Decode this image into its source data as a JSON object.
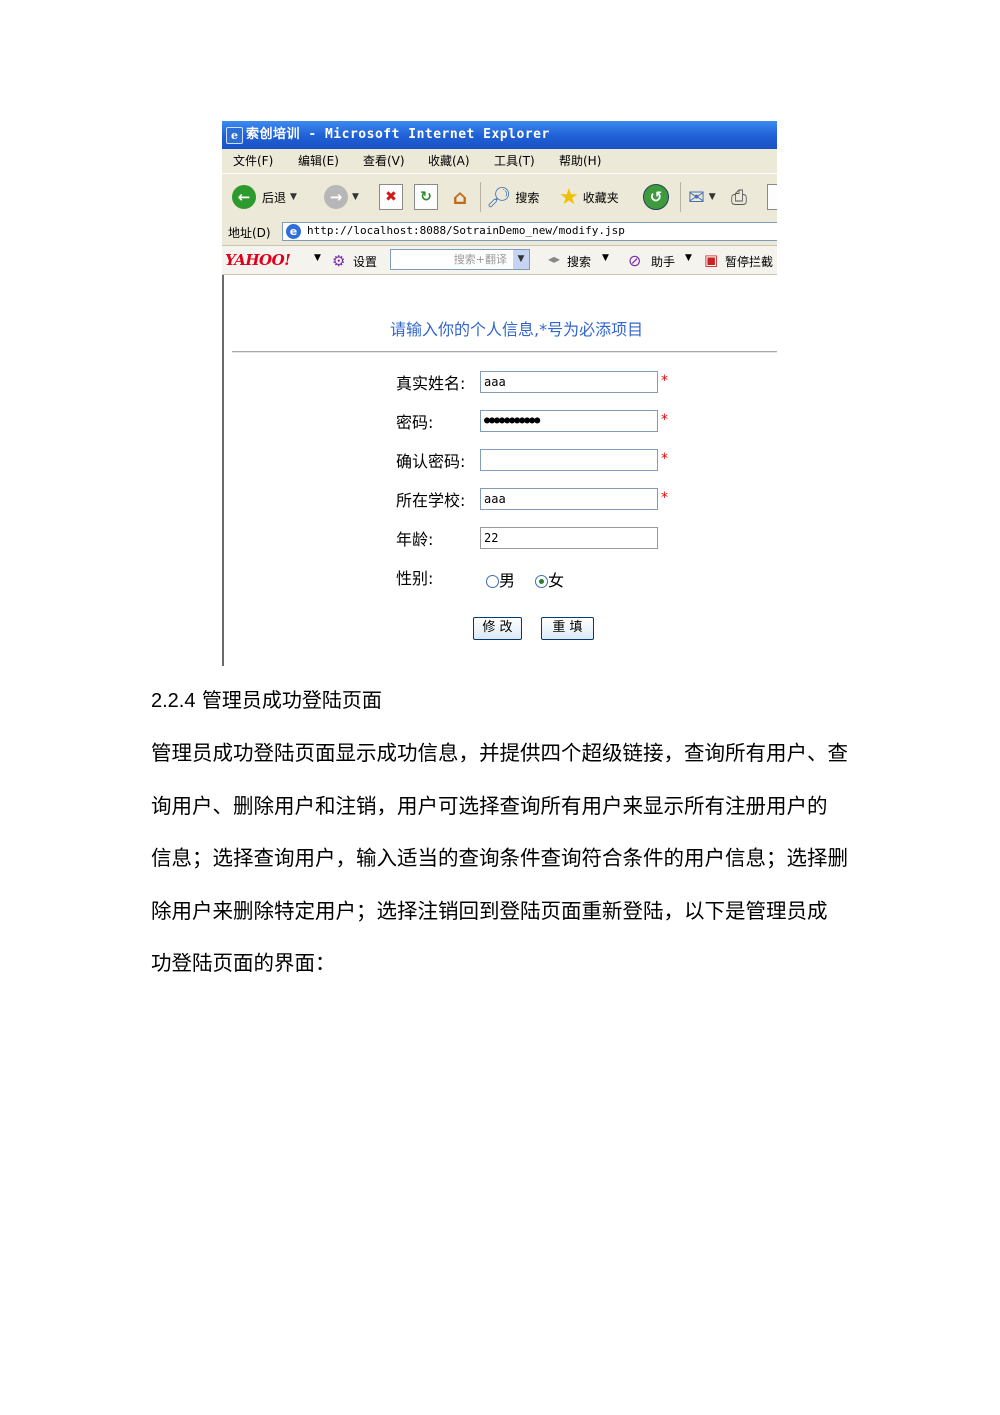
{
  "browser": {
    "window_title": "索创培训 - Microsoft Internet Explorer",
    "menu": [
      "文件(F)",
      "编辑(E)",
      "查看(V)",
      "收藏(A)",
      "工具(T)",
      "帮助(H)"
    ],
    "toolbar": {
      "back": "后退",
      "search": "搜索",
      "favorites": "收藏夹"
    },
    "address": {
      "label": "地址(D)",
      "url": "http://localhost:8088/SotrainDemo_new/modify.jsp"
    },
    "yahoo_bar": {
      "logo": "YAHOO!",
      "settings": "设置",
      "search_placeholder": "搜索+翻译",
      "search_button": "搜索",
      "helper": "助手",
      "popup_block": "暂停拦截"
    }
  },
  "form": {
    "heading": "请输入你的个人信息,*号为必添项目",
    "fields": [
      {
        "label": "真实姓名:",
        "value": "aaa",
        "required": "*"
      },
      {
        "label": "密码:",
        "value": "●●●●●●●●●●●",
        "required": "*"
      },
      {
        "label": "确认密码:",
        "value": "",
        "required": "*"
      },
      {
        "label": "所在学校:",
        "value": "aaa",
        "required": "*"
      },
      {
        "label": "年龄:",
        "value": "22",
        "required": ""
      }
    ],
    "gender": {
      "label": "性别:",
      "male": "男",
      "female": "女",
      "selected": "女"
    },
    "buttons": {
      "modify": "修 改",
      "reset": "重 填"
    }
  },
  "document": {
    "section_number": "2.2.4",
    "section_title": "管理员成功登陆页面",
    "paragraph_lines": [
      "管理员成功登陆页面显示成功信息，并提供四个超级链接，查询所有用户、查",
      "询用户、删除用户和注销，用户可选择查询所有用户来显示所有注册用户的",
      "信息；选择查询用户，输入适当的查询条件查询符合条件的用户信息；选择删",
      "除用户来删除特定用户；选择注销回到登陆页面重新登陆，以下是管理员成",
      "功登陆页面的界面："
    ]
  }
}
